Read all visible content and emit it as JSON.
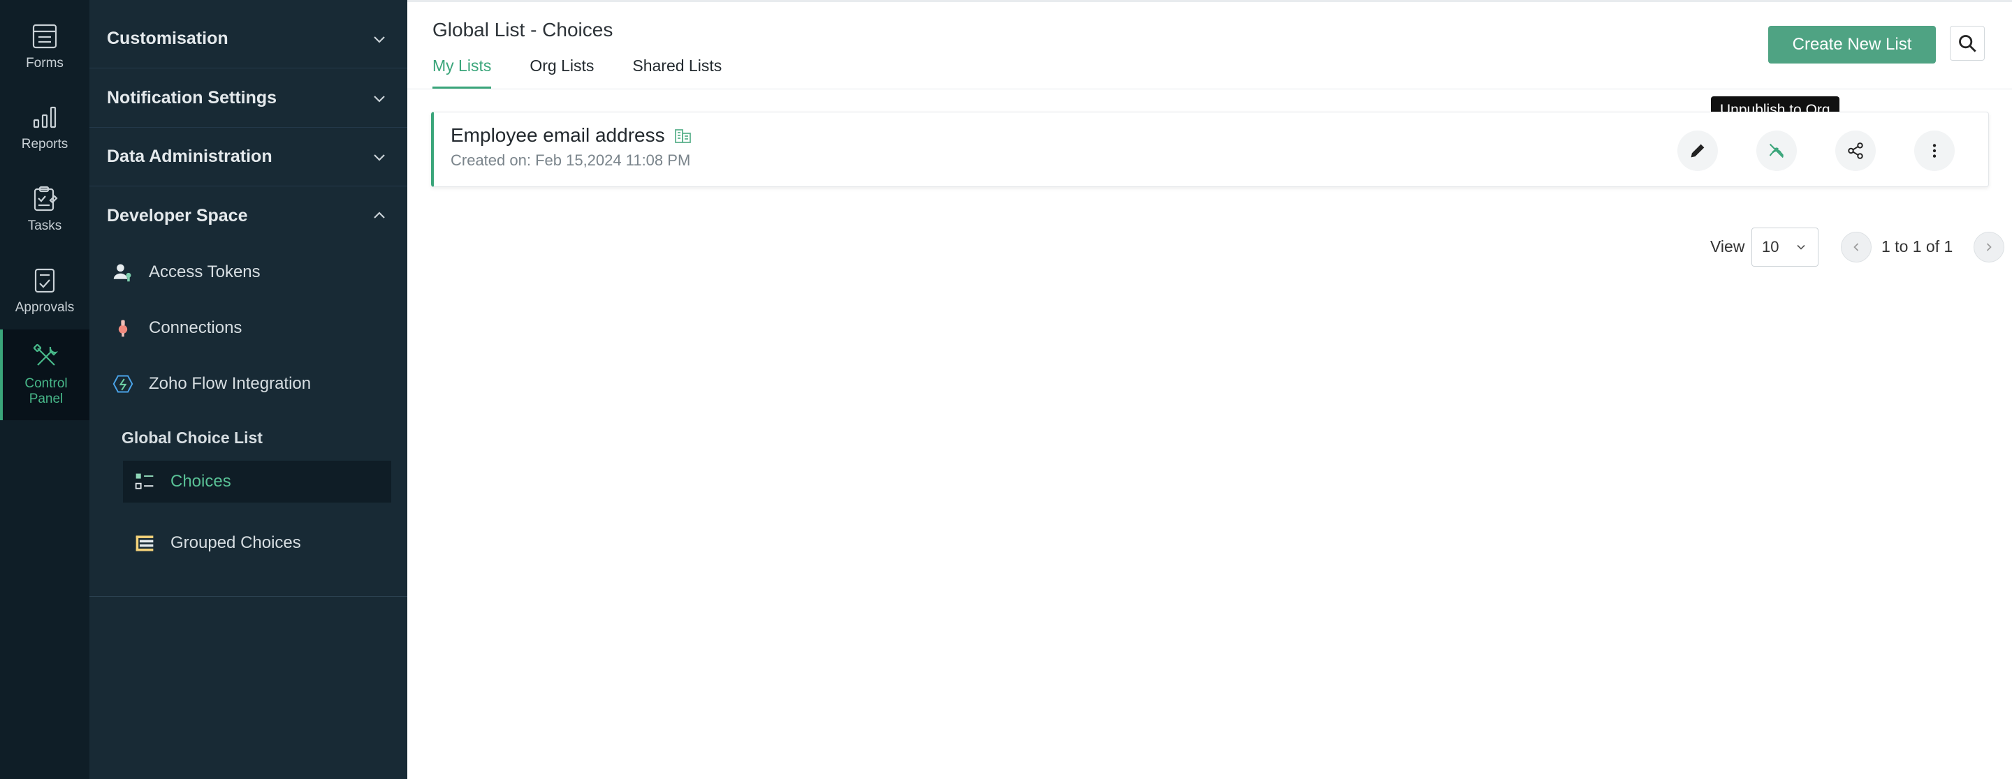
{
  "rail": {
    "items": [
      {
        "label": "Forms"
      },
      {
        "label": "Reports"
      },
      {
        "label": "Tasks"
      },
      {
        "label": "Approvals"
      },
      {
        "label": "Control\nPanel"
      }
    ]
  },
  "sidebar": {
    "sections": [
      {
        "label": "Customisation"
      },
      {
        "label": "Notification Settings"
      },
      {
        "label": "Data Administration"
      },
      {
        "label": "Developer Space"
      }
    ],
    "developer_items": [
      {
        "label": "Access Tokens"
      },
      {
        "label": "Connections"
      },
      {
        "label": "Zoho Flow Integration"
      }
    ],
    "group_title": "Global Choice List",
    "group_items": [
      {
        "label": "Choices"
      },
      {
        "label": "Grouped Choices"
      }
    ]
  },
  "main": {
    "title": "Global List - Choices",
    "tabs": [
      {
        "label": "My Lists"
      },
      {
        "label": "Org Lists"
      },
      {
        "label": "Shared Lists"
      }
    ],
    "create_label": "Create New List",
    "card": {
      "title": "Employee email address",
      "created": "Created on: Feb 15,2024 11:08 PM"
    },
    "tooltip": "Unpublish to Org",
    "pager": {
      "view_label": "View",
      "page_size": "10",
      "range": "1 to 1 of 1"
    }
  },
  "colors": {
    "accent": "#3aa57a",
    "button": "#4fa383",
    "rail_bg": "#0f1e27",
    "sidebar_bg": "#182a35"
  }
}
